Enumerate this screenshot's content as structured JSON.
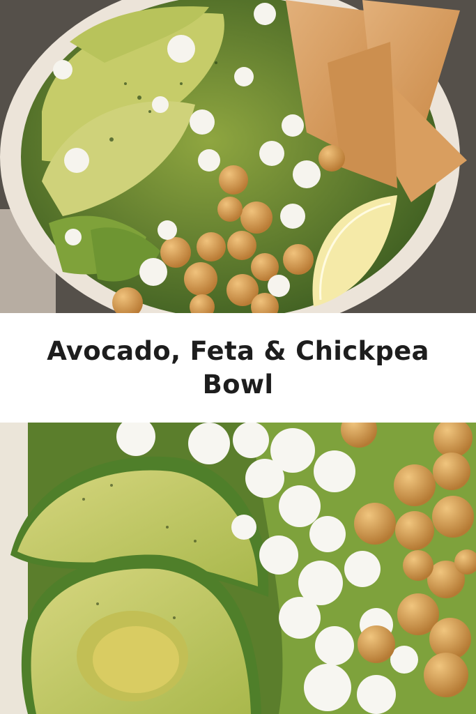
{
  "pin": {
    "title": "Avocado, Feta & Chickpea Bowl",
    "top_image": {
      "icon": "avocado-feta-chickpea-bowl-photo"
    },
    "bottom_image": {
      "icon": "avocado-feta-chickpea-closeup-photo"
    },
    "colors": {
      "background": "#ffffff",
      "title_text": "#1d1d1d",
      "avocado": "#b9c35a",
      "avocado_skin": "#4f7f2a",
      "feta": "#f4f2ec",
      "chickpea": "#d9a65c",
      "tortilla": "#d69b5a",
      "lemon": "#f3e7a2",
      "bowl": "#efe7dc",
      "table": "#5a534c"
    }
  }
}
